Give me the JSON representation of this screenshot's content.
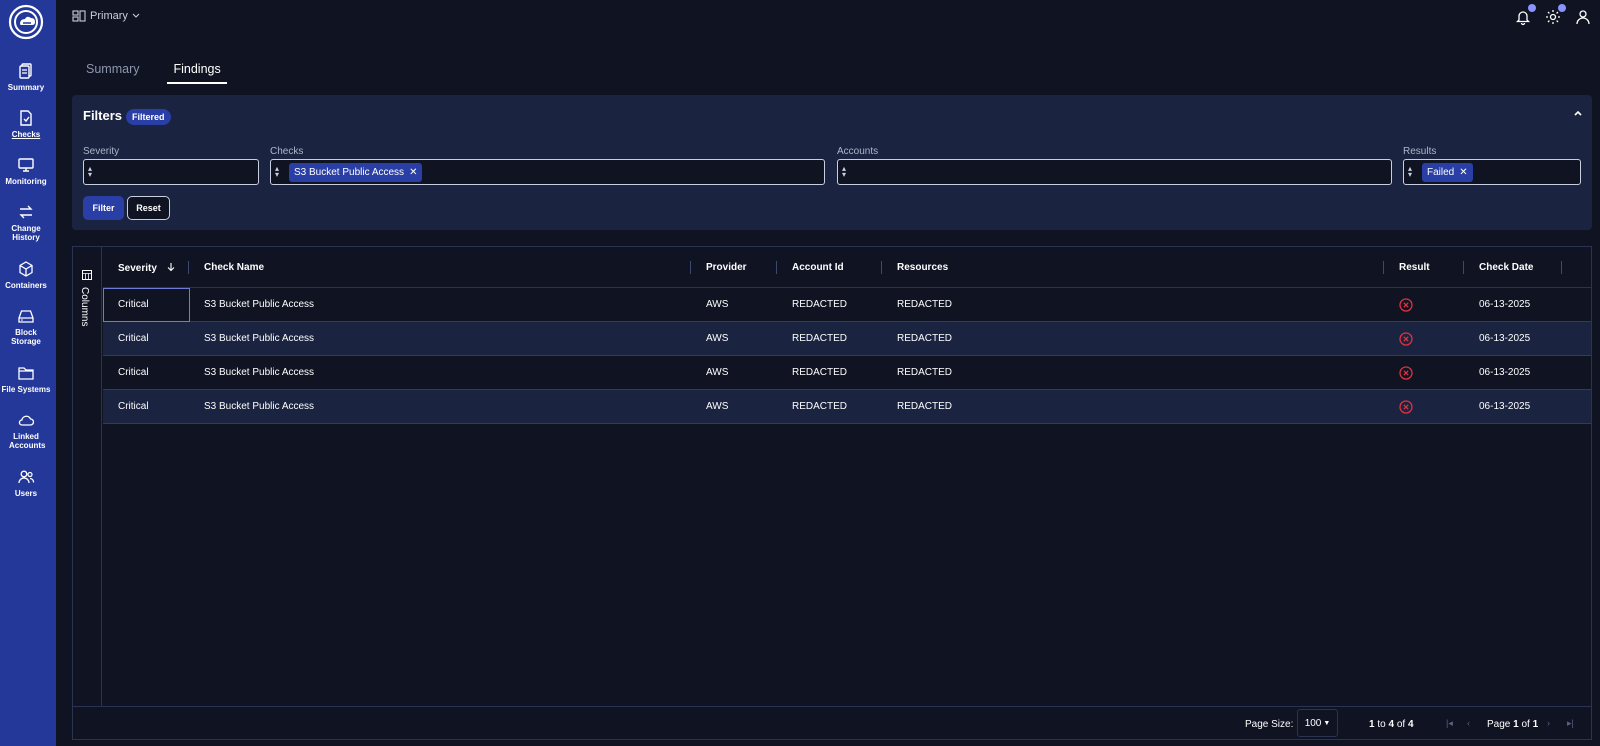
{
  "app": {
    "workspace": "Primary",
    "colors": {
      "sidebar": "#24389a",
      "accent": "#2a3fa6",
      "background": "#0f1322",
      "panel": "#1a2340",
      "fail": "#e0323f",
      "notif_dot": "#8a93ff"
    }
  },
  "sidebar": {
    "items": [
      {
        "label": "Summary",
        "icon": "clipboard-icon"
      },
      {
        "label": "Checks",
        "icon": "file-check-icon",
        "active": true
      },
      {
        "label": "Monitoring",
        "icon": "monitor-icon"
      },
      {
        "label": "Change History",
        "icon": "arrows-swap-icon"
      },
      {
        "label": "Containers",
        "icon": "cube-icon"
      },
      {
        "label": "Block Storage",
        "icon": "hard-drive-icon"
      },
      {
        "label": "File Systems",
        "icon": "folder-icon"
      },
      {
        "label": "Linked Accounts",
        "icon": "cloud-icon"
      },
      {
        "label": "Users",
        "icon": "users-icon"
      }
    ]
  },
  "tabs": [
    "Summary",
    "Findings"
  ],
  "filters": {
    "title": "Filters",
    "badge": "Filtered",
    "severity_label": "Severity",
    "checks_label": "Checks",
    "checks_chip": "S3 Bucket Public Access",
    "accounts_label": "Accounts",
    "results_label": "Results",
    "results_chip": "Failed",
    "filter_button": "Filter",
    "reset_button": "Reset"
  },
  "grid": {
    "columns_label": "Columns",
    "headers": [
      "Severity",
      "Check Name",
      "Provider",
      "Account Id",
      "Resources",
      "Result",
      "Check Date"
    ],
    "rows": [
      {
        "severity": "Critical",
        "check_name": "S3 Bucket Public Access",
        "provider": "AWS",
        "account_id": "REDACTED",
        "resources": "REDACTED",
        "result": "failed",
        "check_date": "06-13-2025"
      },
      {
        "severity": "Critical",
        "check_name": "S3 Bucket Public Access",
        "provider": "AWS",
        "account_id": "REDACTED",
        "resources": "REDACTED",
        "result": "failed",
        "check_date": "06-13-2025"
      },
      {
        "severity": "Critical",
        "check_name": "S3 Bucket Public Access",
        "provider": "AWS",
        "account_id": "REDACTED",
        "resources": "REDACTED",
        "result": "failed",
        "check_date": "06-13-2025"
      },
      {
        "severity": "Critical",
        "check_name": "S3 Bucket Public Access",
        "provider": "AWS",
        "account_id": "REDACTED",
        "resources": "REDACTED",
        "result": "failed",
        "check_date": "06-13-2025"
      }
    ]
  },
  "pagination": {
    "page_size_label": "Page Size:",
    "page_size": "100",
    "range_start": "1",
    "range_to": "to",
    "range_end": "4",
    "range_of": "of",
    "total": "4",
    "page_word": "Page",
    "page": "1",
    "page_of": "of",
    "page_total": "1"
  }
}
